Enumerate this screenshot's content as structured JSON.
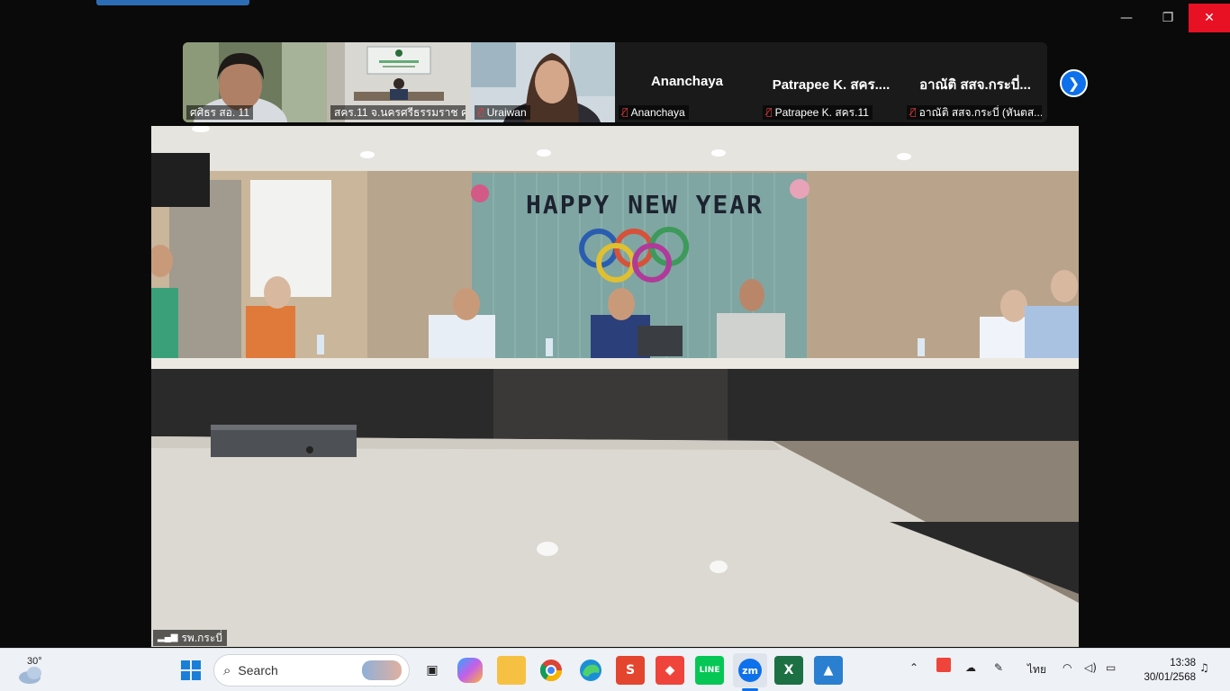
{
  "window": {
    "controls": {
      "minimize": "—",
      "restore": "❐",
      "close": "✕"
    }
  },
  "gallery": {
    "tiles": [
      {
        "label": "ศศิธร สอ. 11",
        "type": "video",
        "muted": false
      },
      {
        "label": "สคร.11 จ.นครศรีธรรมราช คร.",
        "type": "video",
        "muted": false
      },
      {
        "label": "Uraiwan",
        "type": "video",
        "muted": true
      },
      {
        "label": "Ananchaya",
        "display_name": "Ananchaya",
        "type": "name",
        "muted": true
      },
      {
        "label": "Patrapee K. สคร.11",
        "display_name": "Patrapee  K. สคร....",
        "type": "name",
        "muted": true
      },
      {
        "label": "อาณัติ สสจ.กระบี่ (หันตส...",
        "display_name": "อาณัติ สสจ.กระบี่...",
        "type": "name",
        "muted": true
      }
    ],
    "next_icon": "chevron-right-icon"
  },
  "main_video": {
    "banner": "HAPPY NEW YEAR",
    "participant_label": "รพ.กระบี่"
  },
  "taskbar": {
    "weather_temp": "30°",
    "search_placeholder": "Search",
    "apps": [
      "start",
      "search",
      "task-view",
      "copilot",
      "file-explorer",
      "chrome",
      "edge",
      "wps",
      "anydesk",
      "line",
      "zoom",
      "excel",
      "photos"
    ],
    "tray": {
      "language": "ไทย",
      "time": "13:38",
      "date": "30/01/2568"
    }
  },
  "colors": {
    "zoom_blue": "#0e71eb",
    "close_red": "#e81123",
    "muted_red": "#e04040"
  }
}
